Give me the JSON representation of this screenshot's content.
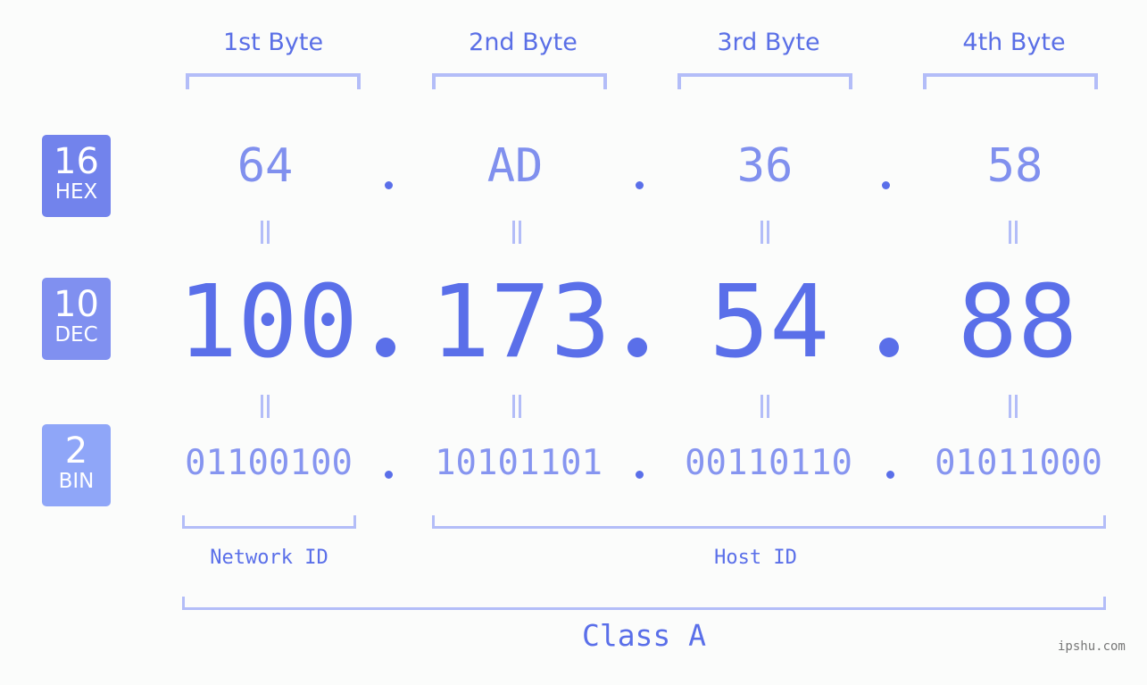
{
  "byte_headers": [
    "1st Byte",
    "2nd Byte",
    "3rd Byte",
    "4th Byte"
  ],
  "badges": [
    {
      "num": "16",
      "label": "HEX",
      "color": "#7283ec"
    },
    {
      "num": "10",
      "label": "DEC",
      "color": "#8090f0"
    },
    {
      "num": "2",
      "label": "BIN",
      "color": "#8fa6f8"
    }
  ],
  "hex": [
    "64",
    "AD",
    "36",
    "58"
  ],
  "dec": [
    "100",
    "173",
    "54",
    "88"
  ],
  "bin": [
    "01100100",
    "10101101",
    "00110110",
    "01011000"
  ],
  "network_id_label": "Network ID",
  "host_id_label": "Host ID",
  "class_label": "Class A",
  "watermark": "ipshu.com"
}
